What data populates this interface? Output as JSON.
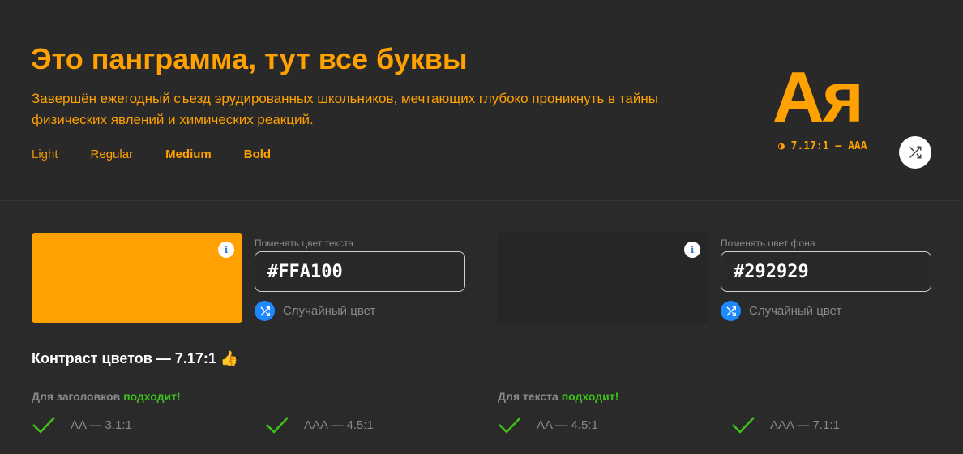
{
  "preview": {
    "title": "Это панграмма, тут все буквы",
    "description": "Завершён ежегодный съезд эрудированных школьников, мечтающих глубоко проникнуть в тайны физических явлений и химических реакций.",
    "weights": [
      "Light",
      "Regular",
      "Medium",
      "Bold"
    ],
    "sample_letters": "Ая",
    "ratio_icon": "◑",
    "ratio_text": "7.17:1 — AAA"
  },
  "text_color": {
    "label": "Поменять цвет текста",
    "value": "#FFA100",
    "random_label": "Случайный цвет",
    "swatch": "#ffa100"
  },
  "bg_color": {
    "label": "Поменять цвет фона",
    "value": "#292929",
    "random_label": "Случайный цвет",
    "swatch": "#292929"
  },
  "contrast": {
    "title": "Контраст цветов — 7.17:1 👍",
    "headings": {
      "label": "Для заголовков",
      "verdict": "подходит!",
      "levels": [
        "AA — 3.1:1",
        "AAA — 4.5:1"
      ]
    },
    "text": {
      "label": "Для текста",
      "verdict": "подходит!",
      "levels": [
        "AA — 4.5:1",
        "AAA — 7.1:1"
      ]
    }
  },
  "colors": {
    "accent": "#ffa100",
    "background": "#292929",
    "success": "#3ec21a",
    "link_blue": "#1e88ff"
  },
  "icons": [
    "contrast-icon",
    "shuffle-icon",
    "info-icon",
    "check-icon"
  ]
}
